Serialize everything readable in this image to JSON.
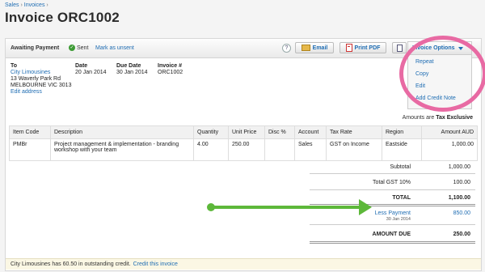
{
  "breadcrumb": {
    "sales": "Sales",
    "sep": "›",
    "invoices": "Invoices",
    "sep2": "›"
  },
  "page_title": "Invoice ORC1002",
  "toolbar": {
    "status": "Awaiting Payment",
    "sent": "Sent",
    "mark_unsent": "Mark as unsent",
    "help": "?",
    "email": "Email",
    "print_pdf": "Print PDF",
    "invoice_options": "Invoice Options"
  },
  "options_menu": [
    "Repeat",
    "Copy",
    "Edit",
    "Add Credit Note"
  ],
  "header": {
    "to_label": "To",
    "to_name": "City Limousines",
    "to_addr1": "13 Waverly Park Rd",
    "to_addr2": "MELBOURNE VIC 3013",
    "edit_address": "Edit address",
    "date_label": "Date",
    "date": "20 Jan 2014",
    "due_label": "Due Date",
    "due": "30 Jan 2014",
    "inv_label": "Invoice #",
    "inv": "ORC1002"
  },
  "amounts_are": {
    "label": "Amounts are",
    "value": "Tax Exclusive"
  },
  "table": {
    "headers": [
      "Item Code",
      "Description",
      "Quantity",
      "Unit Price",
      "Disc %",
      "Account",
      "Tax Rate",
      "Region",
      "Amount AUD"
    ],
    "row": {
      "code": "PMBr",
      "desc": "Project management & implementation - branding workshop with your team",
      "qty": "4.00",
      "price": "250.00",
      "disc": "",
      "account": "Sales",
      "tax": "GST on Income",
      "region": "Eastside",
      "amount": "1,000.00"
    }
  },
  "totals": {
    "subtotal_label": "Subtotal",
    "subtotal": "1,000.00",
    "gst_label": "Total GST  10%",
    "gst": "100.00",
    "total_label": "TOTAL",
    "total": "1,100.00",
    "less_payment_label": "Less Payment",
    "less_payment_date": "30 Jan 2014",
    "less_payment": "850.00",
    "amount_due_label": "AMOUNT DUE",
    "amount_due": "250.00"
  },
  "footer": {
    "text": "City Limousines has 60.50 in outstanding credit.",
    "link": "Credit this invoice"
  },
  "colors": {
    "link": "#1f6db3",
    "highlight": "#e86aa3",
    "arrow": "#5db83a"
  }
}
